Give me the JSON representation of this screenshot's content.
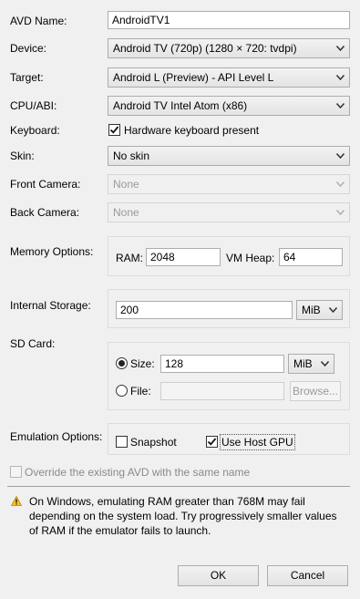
{
  "avd_name": {
    "label": "AVD Name:",
    "value": "AndroidTV1"
  },
  "device": {
    "label": "Device:",
    "value": "Android TV (720p) (1280 × 720: tvdpi)"
  },
  "target": {
    "label": "Target:",
    "value": "Android L (Preview) - API Level L"
  },
  "cpu_abi": {
    "label": "CPU/ABI:",
    "value": "Android TV Intel Atom (x86)"
  },
  "keyboard": {
    "label": "Keyboard:",
    "checkbox_label": "Hardware keyboard present",
    "checked": true
  },
  "skin": {
    "label": "Skin:",
    "value": "No skin"
  },
  "front_camera": {
    "label": "Front Camera:",
    "value": "None"
  },
  "back_camera": {
    "label": "Back Camera:",
    "value": "None"
  },
  "memory": {
    "label": "Memory Options:",
    "ram_label": "RAM:",
    "ram_value": "2048",
    "vm_heap_label": "VM Heap:",
    "vm_heap_value": "64"
  },
  "internal_storage": {
    "label": "Internal Storage:",
    "value": "200",
    "unit": "MiB"
  },
  "sd_card": {
    "label": "SD Card:",
    "size_label": "Size:",
    "size_value": "128",
    "size_unit": "MiB",
    "size_selected": true,
    "file_label": "File:",
    "file_value": "",
    "browse_label": "Browse..."
  },
  "emulation": {
    "label": "Emulation Options:",
    "snapshot_label": "Snapshot",
    "snapshot_checked": false,
    "host_gpu_label": "Use Host GPU",
    "host_gpu_checked": true
  },
  "override": {
    "label": "Override the existing AVD with the same name",
    "checked": false
  },
  "warning": {
    "icon": "warning-icon",
    "text": "On Windows, emulating RAM greater than 768M may fail depending on the system load. Try progressively smaller values of RAM if the emulator fails to launch."
  },
  "buttons": {
    "ok": "OK",
    "cancel": "Cancel"
  }
}
